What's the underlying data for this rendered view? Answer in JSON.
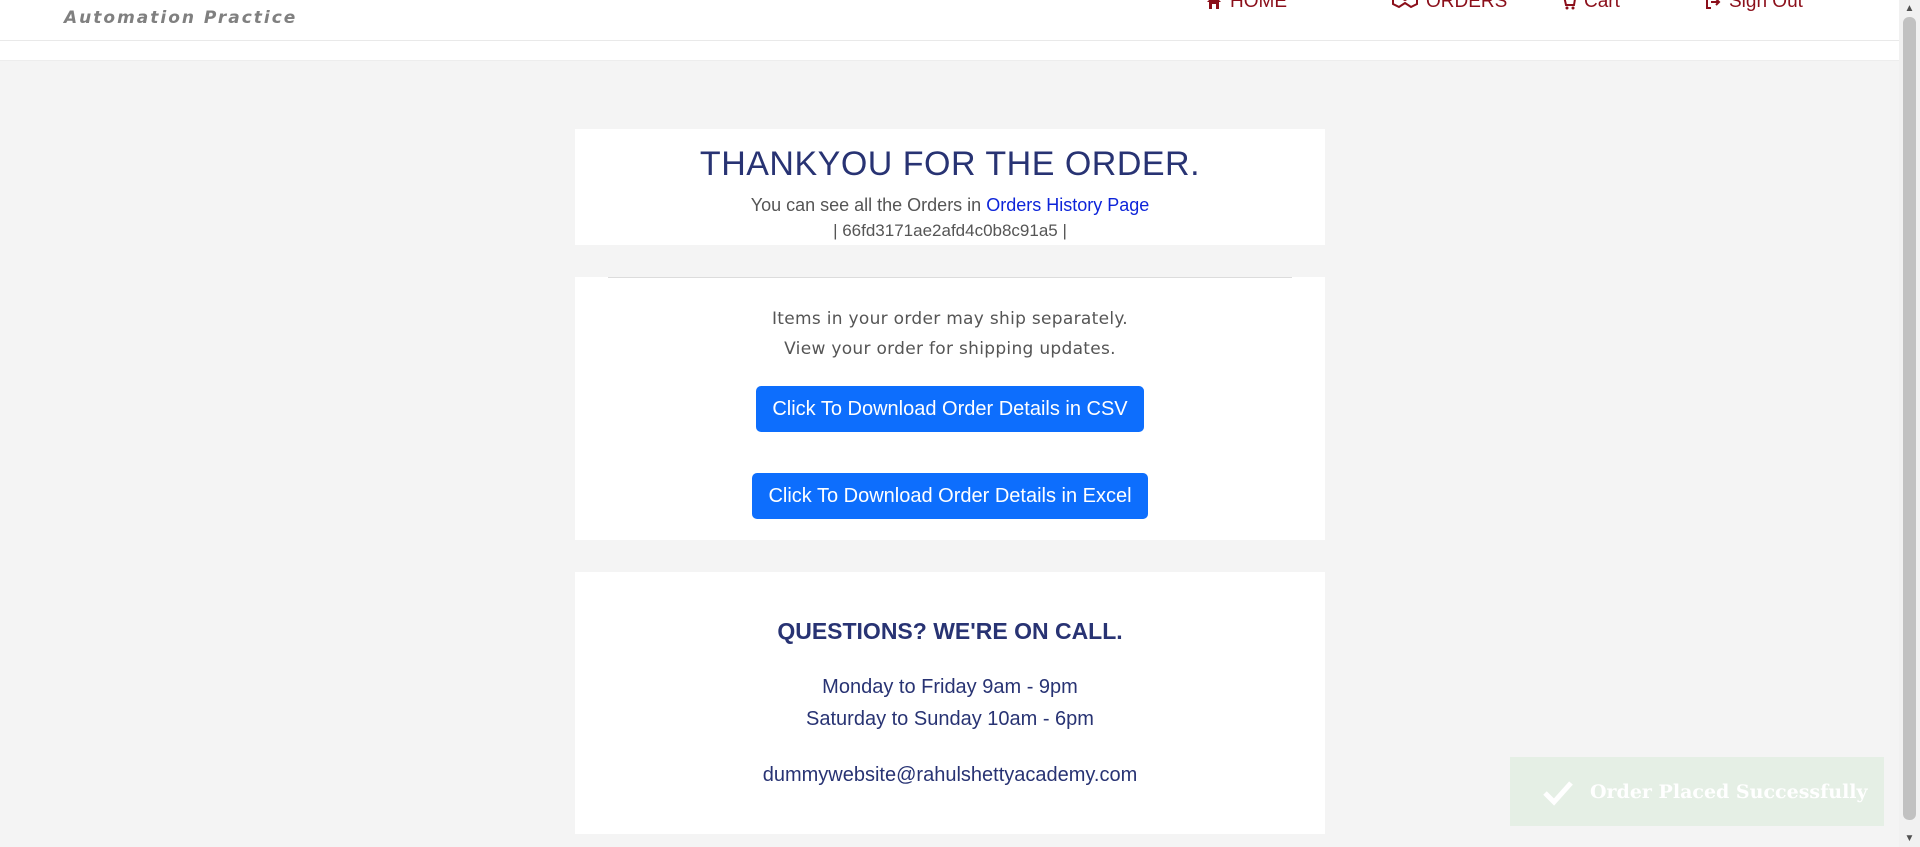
{
  "header": {
    "tagline": "Automation Practice",
    "nav": {
      "home": "HOME",
      "orders": "ORDERS",
      "cart": "Cart",
      "sign_out": "Sign Out"
    }
  },
  "confirmation": {
    "title": "THANKYOU FOR THE ORDER.",
    "history_prefix": "You can see all the Orders in ",
    "history_link": "Orders History Page",
    "order_id_line": "| 66fd3171ae2afd4c0b8c91a5 |"
  },
  "shipping": {
    "note1": "Items in your order may ship separately.",
    "note2": "View your order for shipping updates.",
    "csv_button": "Click To Download Order Details in CSV",
    "excel_button": "Click To Download Order Details in Excel"
  },
  "support": {
    "title": "QUESTIONS? WE'RE ON CALL.",
    "hours_weekday": "Monday to Friday 9am - 9pm",
    "hours_weekend": "Saturday to Sunday 10am - 6pm",
    "email": "dummywebsite@rahulshettyacademy.com"
  },
  "toast": {
    "message": "Order Placed Successfully",
    "icon": "check-icon"
  },
  "colors": {
    "nav": "#8b0f1a",
    "heading": "#283373",
    "primary_button": "#0d6efd",
    "link": "#0d24d9",
    "toast_bg": "#e5efe5"
  }
}
